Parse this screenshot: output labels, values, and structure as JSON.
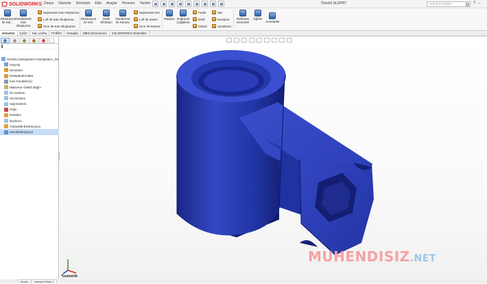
{
  "app": {
    "logo_text": "SOLIDWORKS",
    "document_title": "Örnek5.SLDPRT"
  },
  "menu": [
    "Dosya",
    "Düzenle",
    "Görünüm",
    "Ekle",
    "Araçlar",
    "Pencere",
    "Yardım"
  ],
  "search": {
    "placeholder": "Arama Komutları"
  },
  "ribbon": {
    "extrude_boss": "Ekstrüzyon ile Kat...",
    "revolve_boss": "Döndürerek Katı Oluşturma",
    "sweep_boss": "Süpürerek Katı Oluşturma",
    "loft_boss": "Loft ile Katı Oluşturma",
    "boundary_boss": "Sınır ile Katı Oluşturma",
    "extrude_cut": "Ekstrüzyon ile Kes",
    "hole_wizard": "Delik Sihirbazı",
    "revolve_cut": "Döndürme ile Kesme",
    "sweep_cut": "Süpürerek Kes",
    "loft_cut": "Loft ile Kesim",
    "boundary_cut": "Sınır ile Kesme",
    "fillet": "Radyus",
    "linear_pattern": "Doğrusal Çoğaltma",
    "rib": "Feder",
    "draft": "Draft",
    "shell": "Kabuk",
    "wrap": "Sar",
    "intersect": "Kesişme",
    "mirror": "Aynalama",
    "reference_geometry": "Referans Geometri",
    "curves": "Eğriler",
    "instant3d": "Anında3B"
  },
  "tabs": [
    "Unsurlar",
    "Çizim",
    "Sac Levha",
    "Profiller",
    "Hesapla",
    "MBD Dimensions",
    "SOLIDWORKS Eklentileri"
  ],
  "tree": [
    {
      "label": "Örnek5 (Varsayılan<<Varsayılan>_Gö",
      "color": "#7da4d8"
    },
    {
      "label": "Geçmiş",
      "color": "#7aa0d0"
    },
    {
      "label": "Sensörler",
      "color": "#e09a30"
    },
    {
      "label": "Detaylandırmalar",
      "color": "#d0a040"
    },
    {
      "label": "Katı Gövdeler(1)",
      "color": "#8899aa"
    },
    {
      "label": "Malzeme <belirli değil>",
      "color": "#c9b06a"
    },
    {
      "label": "Ön Düzlem",
      "color": "#9fc0e8"
    },
    {
      "label": "Üst Düzlem",
      "color": "#9fc0e8"
    },
    {
      "label": "Sağ Düzlem",
      "color": "#9fc0e8"
    },
    {
      "label": "Orijin",
      "color": "#cc4444"
    },
    {
      "label": "Döndür1",
      "color": "#e0a040"
    },
    {
      "label": "Düzlem1",
      "color": "#9fc0e8"
    },
    {
      "label": "Yükseklik-Ekstrüzyon1",
      "color": "#e0a040"
    },
    {
      "label": "Kes-Ekstrüzyon2",
      "color": "#5a90d0"
    }
  ],
  "viewport": {
    "view_name": "*İzometrik",
    "part_color": "#2a3aa8"
  },
  "bottom_tabs": [
    "Model",
    "Hareket Etüdü 1"
  ],
  "watermark": {
    "brand": "MUHENDISIZ",
    "tld": ".NET"
  }
}
